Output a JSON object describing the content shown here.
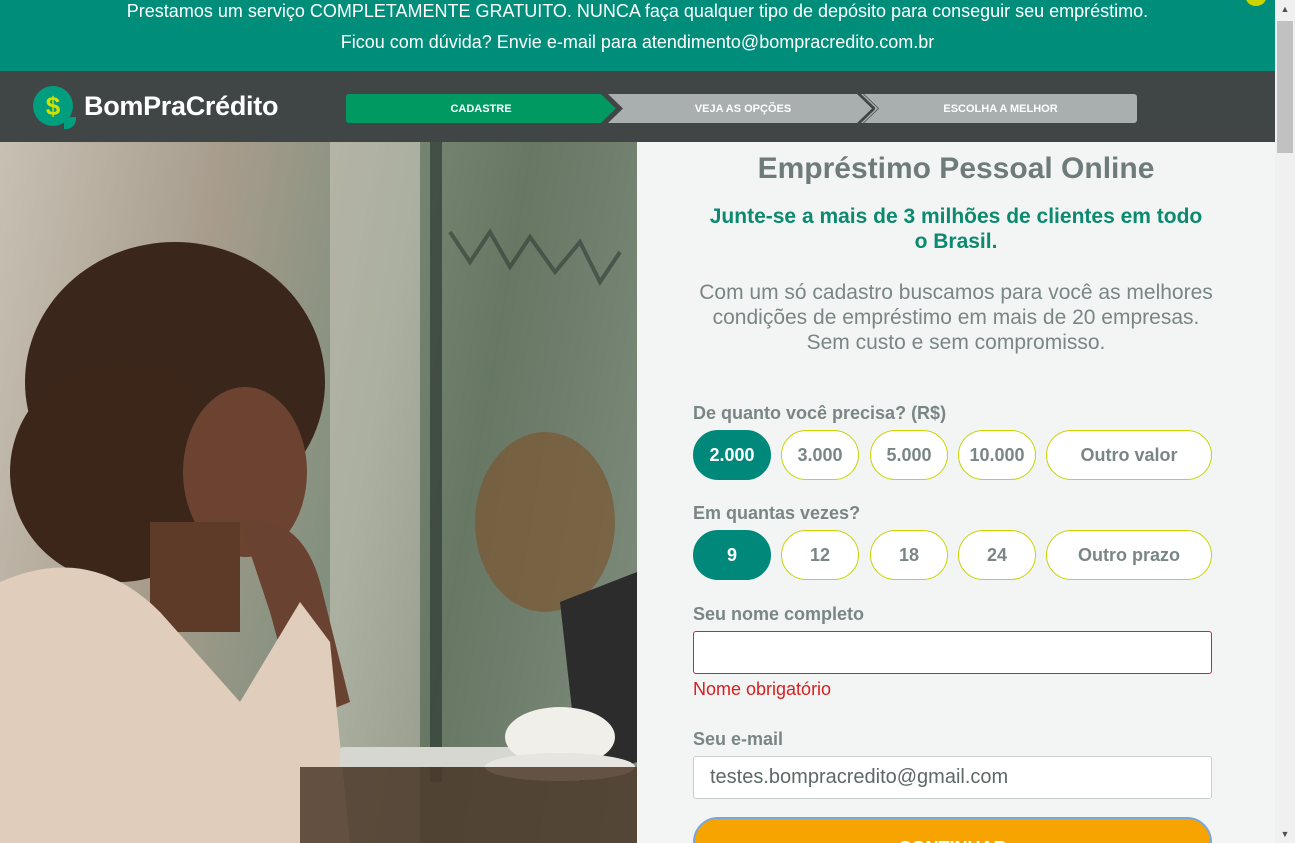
{
  "banner": {
    "line1": "Prestamos um serviço COMPLETAMENTE GRATUITO. NUNCA faça qualquer tipo de depósito para conseguir seu empréstimo.",
    "line2": "Ficou com dúvida? Envie e-mail para atendimento@bompracredito.com.br"
  },
  "brand": {
    "logo_symbol": "$",
    "name": "BomPraCrédito"
  },
  "steps": [
    {
      "label": "CADASTRE",
      "active": true
    },
    {
      "label": "VEJA AS OPÇÕES",
      "active": false
    },
    {
      "label": "ESCOLHA A MELHOR",
      "active": false
    }
  ],
  "form": {
    "title": "Empréstimo Pessoal Online",
    "subtitle": "Junte-se a mais de 3 milhões de clientes em todo o Brasil.",
    "intro_line1": "Com um só cadastro buscamos para você as melhores condições de empréstimo em mais de 20 empresas.",
    "intro_line2": "Sem custo e sem compromisso.",
    "amount": {
      "label": "De quanto você precisa? (R$)",
      "options": [
        "2.000",
        "3.000",
        "5.000",
        "10.000",
        "Outro valor"
      ],
      "selected": "2.000"
    },
    "installments": {
      "label": "Em quantas vezes?",
      "options": [
        "9",
        "12",
        "18",
        "24",
        "Outro prazo"
      ],
      "selected": "9"
    },
    "name": {
      "label": "Seu nome completo",
      "value": "",
      "error": "Nome obrigatório"
    },
    "email": {
      "label": "Seu e-mail",
      "value": "testes.bompracredito@gmail.com"
    },
    "submit_label": "CONTINUAR"
  },
  "colors": {
    "primary_green": "#008e7b",
    "header_dark": "#3f4645",
    "step_active": "#009962",
    "accent_yellow": "#c8d400",
    "cta_orange": "#f7a400",
    "error_red": "#d81e1e"
  },
  "icons": {
    "close": "close-icon",
    "scroll_up": "chevron-up-icon",
    "scroll_down": "chevron-down-icon"
  }
}
